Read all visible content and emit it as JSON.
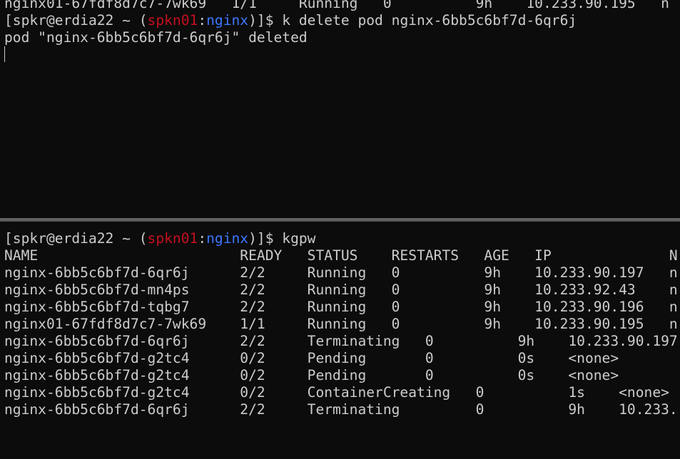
{
  "top_pane": {
    "clipped_line": "nginx01-67fdf8d7c7-7wk69   1/1     Running   0          9h    10.233.90.195   n",
    "prompt": {
      "user_host": "spkr@erdia22",
      "dir": "~",
      "context": "spkn01",
      "namespace": "nginx",
      "command": "k delete pod nginx-6bb5c6bf7d-6qr6j"
    },
    "output": "pod \"nginx-6bb5c6bf7d-6qr6j\" deleted"
  },
  "bottom_pane": {
    "prompt": {
      "user_host": "spkr@erdia22",
      "dir": "~",
      "context": "spkn01",
      "namespace": "nginx",
      "command": "kgpw"
    },
    "lines": [
      "NAME                        READY   STATUS    RESTARTS   AGE   IP              N",
      "nginx-6bb5c6bf7d-6qr6j      2/2     Running   0          9h    10.233.90.197   n",
      "nginx-6bb5c6bf7d-mn4ps      2/2     Running   0          9h    10.233.92.43    n",
      "nginx-6bb5c6bf7d-tqbg7      2/2     Running   0          9h    10.233.90.196   n",
      "nginx01-67fdf8d7c7-7wk69    1/1     Running   0          9h    10.233.90.195   n",
      "nginx-6bb5c6bf7d-6qr6j      2/2     Terminating   0          9h    10.233.90.197",
      "nginx-6bb5c6bf7d-g2tc4      0/2     Pending       0          0s    <none>",
      "nginx-6bb5c6bf7d-g2tc4      0/2     Pending       0          0s    <none>",
      "nginx-6bb5c6bf7d-g2tc4      0/2     ContainerCreating   0          1s    <none>",
      "nginx-6bb5c6bf7d-6qr6j      2/2     Terminating         0          9h    10.233."
    ]
  }
}
